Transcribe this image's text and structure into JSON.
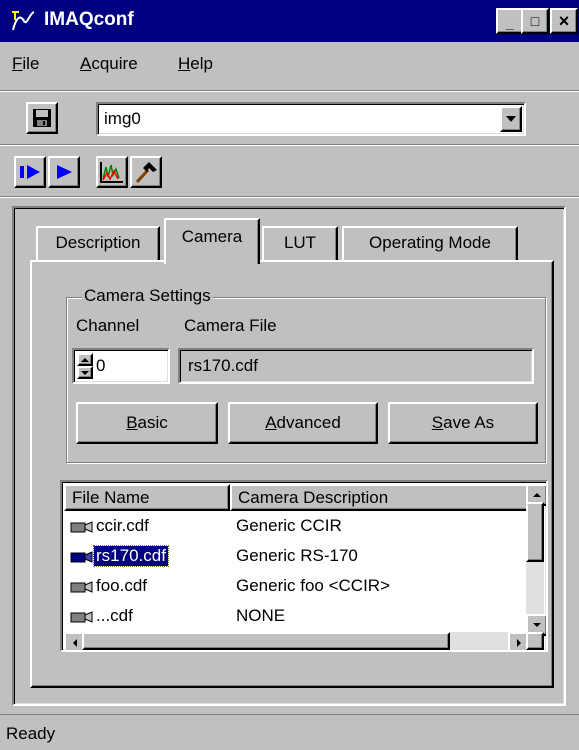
{
  "window": {
    "title": "IMAQconf",
    "icon": "imaq-app-icon",
    "caption_buttons": {
      "minimize": "_",
      "maximize": "□",
      "close": "×"
    }
  },
  "menu": [
    {
      "pre": "",
      "accel": "F",
      "post": "ile"
    },
    {
      "pre": "",
      "accel": "A",
      "post": "cquire"
    },
    {
      "pre": "",
      "accel": "H",
      "post": "elp"
    }
  ],
  "device": {
    "selected": "img0"
  },
  "toolbar": {
    "icons": [
      "save-icon",
      "snap-icon",
      "grab-icon",
      "histogram-icon",
      "hammer-icon"
    ]
  },
  "tabs": [
    "Description",
    "Camera",
    "LUT",
    "Operating Mode"
  ],
  "active_tab": "Camera",
  "camera_settings": {
    "group_title": "Camera Settings",
    "channel_label": "Channel",
    "camera_file_label": "Camera File",
    "channel_value": "0",
    "camera_file_value": "rs170.cdf"
  },
  "buttons": {
    "basic": {
      "pre": "",
      "accel": "B",
      "post": "asic"
    },
    "advanced": {
      "pre": "",
      "accel": "A",
      "post": "dvanced"
    },
    "save_as": {
      "pre": "",
      "accel": "S",
      "post": "ave As"
    }
  },
  "camera_list": {
    "columns": [
      "File Name",
      "Camera Description"
    ],
    "rows": [
      {
        "file": "ccir.cdf",
        "description": "Generic CCIR",
        "selected": false
      },
      {
        "file": "rs170.cdf",
        "description": "Generic RS-170",
        "selected": true
      },
      {
        "file": "foo.cdf",
        "description": "Generic foo <CCIR>",
        "selected": false
      },
      {
        "file": "...cdf",
        "description": "NONE",
        "selected": false
      }
    ]
  },
  "status": {
    "text": "Ready"
  },
  "colors": {
    "titlebar": "#000080",
    "face": "#c0c0c0",
    "selection": "#000080",
    "icon_blue": "#0000ff"
  }
}
